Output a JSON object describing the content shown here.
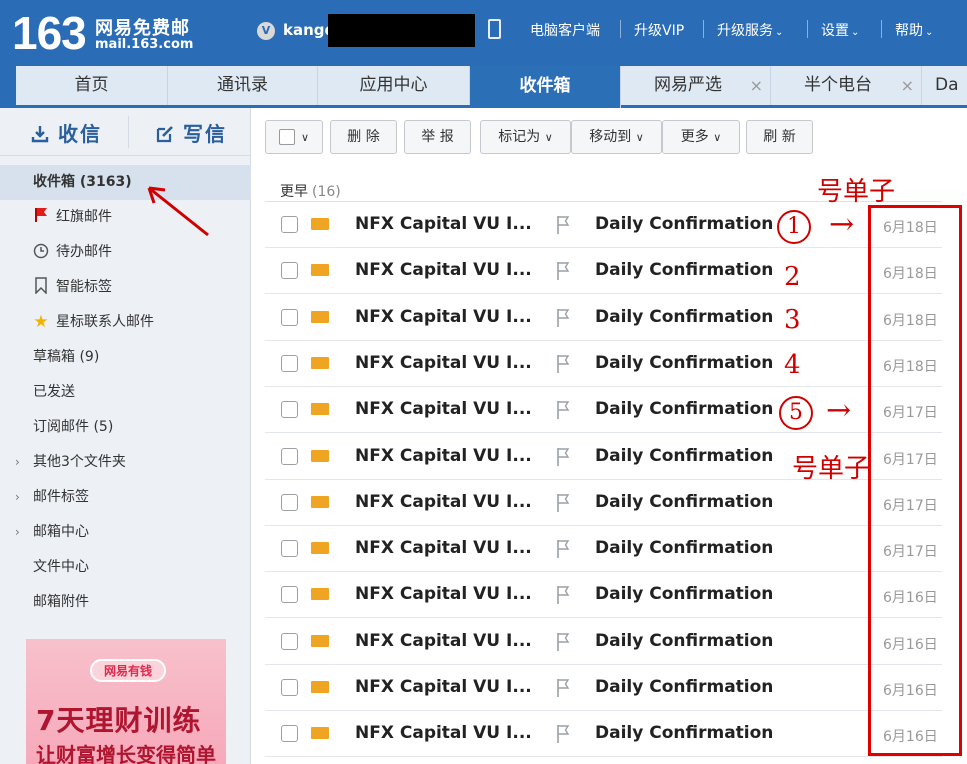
{
  "header": {
    "logo_number": "163",
    "logo_text": "网易免费邮",
    "logo_domain": "mail.163.com",
    "user_badge": "V",
    "username": "kangd",
    "nav": [
      {
        "label": "电脑客户端",
        "caret": false
      },
      {
        "label": "升级VIP",
        "caret": false
      },
      {
        "label": "升级服务",
        "caret": true
      },
      {
        "label": "设置",
        "caret": true
      },
      {
        "label": "帮助",
        "caret": true
      }
    ]
  },
  "tabs": [
    {
      "label": "首页",
      "active": false,
      "closable": false
    },
    {
      "label": "通讯录",
      "active": false,
      "closable": false
    },
    {
      "label": "应用中心",
      "active": false,
      "closable": false
    },
    {
      "label": "收件箱",
      "active": true,
      "closable": false
    },
    {
      "label": "网易严选",
      "active": false,
      "closable": true
    },
    {
      "label": "半个电台",
      "active": false,
      "closable": true
    },
    {
      "label": "Da",
      "active": false,
      "closable": false
    }
  ],
  "sidebar": {
    "receive_label": "收信",
    "compose_label": "写信",
    "folders": [
      {
        "label": "收件箱 (3163)",
        "icon": "",
        "arrow": false
      },
      {
        "label": "红旗邮件",
        "icon": "red-flag-icon",
        "arrow": false
      },
      {
        "label": "待办邮件",
        "icon": "clock-icon",
        "arrow": false
      },
      {
        "label": "智能标签",
        "icon": "bookmark-icon",
        "arrow": false
      },
      {
        "label": "星标联系人邮件",
        "icon": "star-icon",
        "arrow": false
      },
      {
        "label": "草稿箱 (9)",
        "icon": "",
        "arrow": false
      },
      {
        "label": "已发送",
        "icon": "",
        "arrow": false
      },
      {
        "label": "订阅邮件 (5)",
        "icon": "",
        "arrow": false
      },
      {
        "label": "其他3个文件夹",
        "icon": "",
        "arrow": true
      },
      {
        "label": "邮件标签",
        "icon": "",
        "arrow": true
      },
      {
        "label": "邮箱中心",
        "icon": "",
        "arrow": true
      },
      {
        "label": "文件中心",
        "icon": "",
        "arrow": false
      },
      {
        "label": "邮箱附件",
        "icon": "",
        "arrow": false
      }
    ],
    "ad": {
      "badge": "网易有钱",
      "title": "7天理财训练",
      "subtitle": "让财富增长变得简单"
    }
  },
  "toolbar": {
    "delete": "删 除",
    "report": "举 报",
    "mark_as": "标记为",
    "move_to": "移动到",
    "more": "更多",
    "refresh": "刷 新"
  },
  "list": {
    "section_label": "更早",
    "section_count": "(16)",
    "rows": [
      {
        "sender": "NFX Capital VU I...",
        "subject": "Daily Confirmation",
        "date": "6月18日"
      },
      {
        "sender": "NFX Capital VU I...",
        "subject": "Daily Confirmation",
        "date": "6月18日"
      },
      {
        "sender": "NFX Capital VU I...",
        "subject": "Daily Confirmation",
        "date": "6月18日"
      },
      {
        "sender": "NFX Capital VU I...",
        "subject": "Daily Confirmation",
        "date": "6月18日"
      },
      {
        "sender": "NFX Capital VU I...",
        "subject": "Daily Confirmation",
        "date": "6月17日"
      },
      {
        "sender": "NFX Capital VU I...",
        "subject": "Daily Confirmation",
        "date": "6月17日"
      },
      {
        "sender": "NFX Capital VU I...",
        "subject": "Daily Confirmation",
        "date": "6月17日"
      },
      {
        "sender": "NFX Capital VU I...",
        "subject": "Daily Confirmation",
        "date": "6月17日"
      },
      {
        "sender": "NFX Capital VU I...",
        "subject": "Daily Confirmation",
        "date": "6月16日"
      },
      {
        "sender": "NFX Capital VU I...",
        "subject": "Daily Confirmation",
        "date": "6月16日"
      },
      {
        "sender": "NFX Capital VU I...",
        "subject": "Daily Confirmation",
        "date": "6月16日"
      },
      {
        "sender": "NFX Capital VU I...",
        "subject": "Daily Confirmation",
        "date": "6月16日"
      }
    ]
  },
  "annotations": {
    "label_top": "号单子",
    "label_bottom": "号单子",
    "num_1": "1",
    "num_2": "2",
    "num_3": "3",
    "num_4": "4",
    "num_5": "5",
    "arrow_1": "→",
    "arrow_5": "→"
  }
}
